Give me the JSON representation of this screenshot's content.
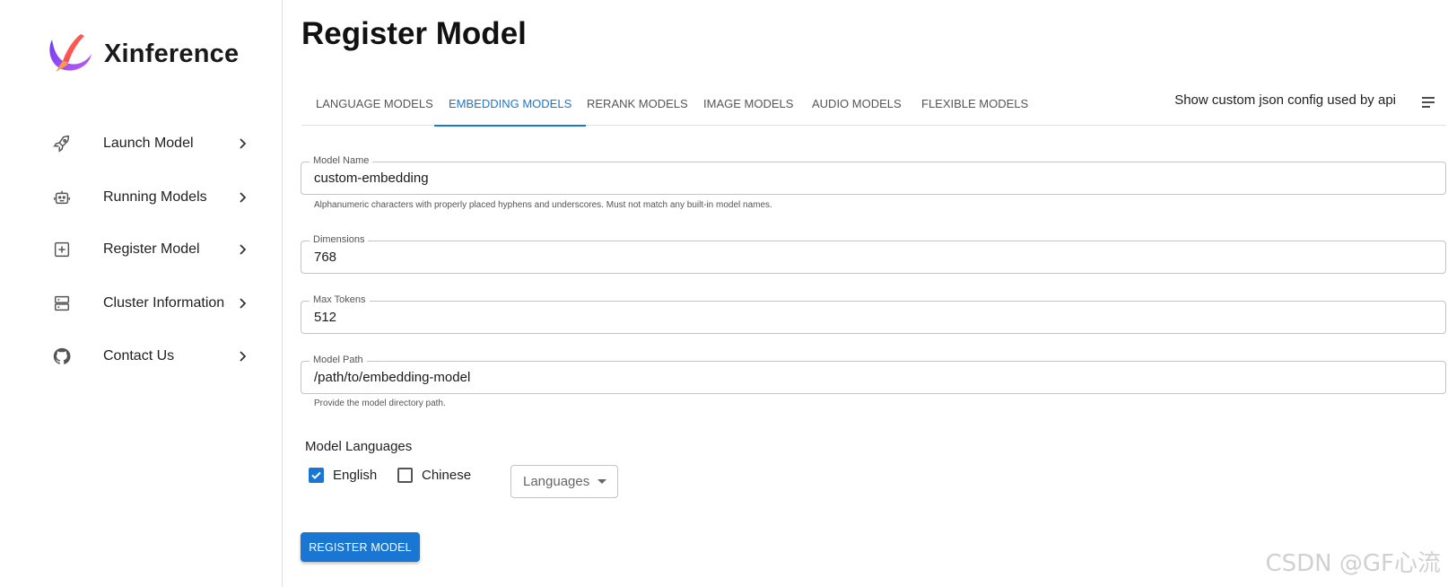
{
  "brand": {
    "name": "Xinference",
    "logo_icon": "xinference-logo"
  },
  "sidebar": {
    "items": [
      {
        "label": "Launch Model",
        "icon": "rocket-icon"
      },
      {
        "label": "Running Models",
        "icon": "robot-icon"
      },
      {
        "label": "Register Model",
        "icon": "add-box-icon"
      },
      {
        "label": "Cluster Information",
        "icon": "server-icon"
      },
      {
        "label": "Contact Us",
        "icon": "github-icon"
      }
    ]
  },
  "page": {
    "title": "Register Model"
  },
  "tabs": [
    {
      "label": "LANGUAGE MODELS",
      "active": false
    },
    {
      "label": "EMBEDDING MODELS",
      "active": true
    },
    {
      "label": "RERANK MODELS",
      "active": false
    },
    {
      "label": "IMAGE MODELS",
      "active": false
    },
    {
      "label": "AUDIO MODELS",
      "active": false
    },
    {
      "label": "FLEXIBLE MODELS",
      "active": false
    }
  ],
  "json_toggle": {
    "label": "Show custom json config used by api"
  },
  "form": {
    "model_name": {
      "label": "Model Name",
      "value": "custom-embedding",
      "helper": "Alphanumeric characters with properly placed hyphens and underscores. Must not match any built-in model names."
    },
    "dimensions": {
      "label": "Dimensions",
      "value": "768"
    },
    "max_tokens": {
      "label": "Max Tokens",
      "value": "512"
    },
    "model_path": {
      "label": "Model Path",
      "value": "/path/to/embedding-model",
      "helper": "Provide the model directory path."
    },
    "languages": {
      "label": "Model Languages",
      "options": [
        {
          "label": "English",
          "checked": true
        },
        {
          "label": "Chinese",
          "checked": false
        }
      ],
      "select_placeholder": "Languages"
    },
    "submit_label": "REGISTER MODEL"
  },
  "watermark": "CSDN @GF心流",
  "colors": {
    "accent": "#1976d2",
    "border": "#c4c4c4"
  }
}
